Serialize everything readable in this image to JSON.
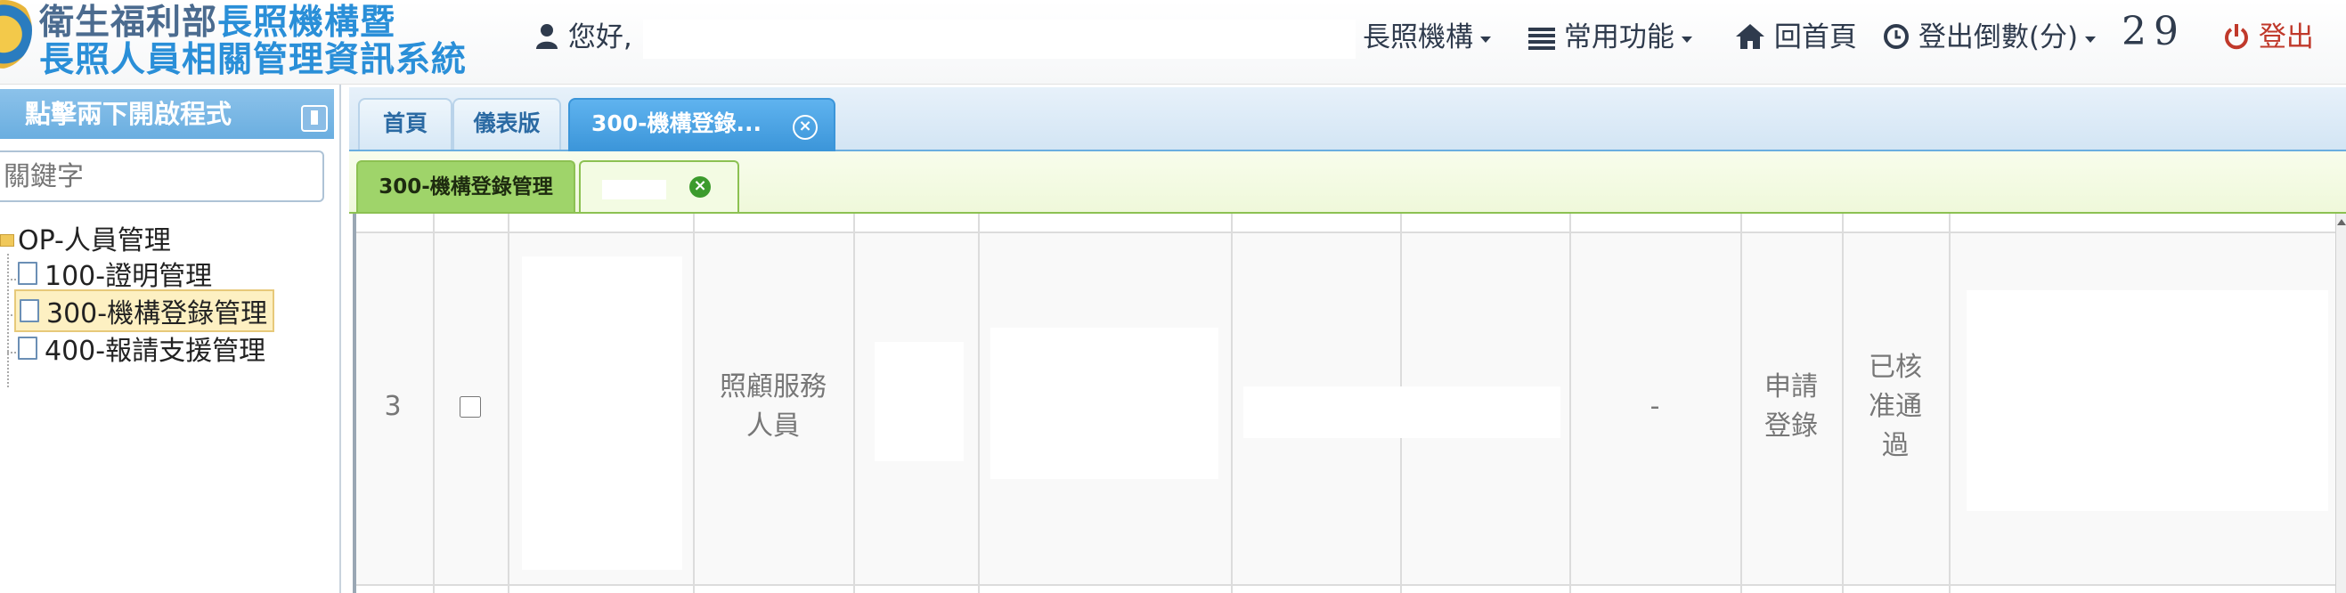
{
  "header": {
    "title_line1_part1": "衛生福利部",
    "title_line1_part2": "長照機構暨",
    "title_line2": "長照人員相關管理資訊系統",
    "greeting": "您好,",
    "nav": {
      "org": "長照機構",
      "common": "常用功能",
      "home": "回首頁",
      "logout_timer": "登出倒數(分)",
      "countdown": "29",
      "logout": "登出"
    }
  },
  "sidebar": {
    "title": "點擊兩下開啟程式",
    "search_placeholder": "關鍵字",
    "tree": {
      "root": "OP-人員管理",
      "items": [
        {
          "label": "100-證明管理"
        },
        {
          "label": "300-機構登錄管理"
        },
        {
          "label": "400-報請支援管理"
        }
      ]
    }
  },
  "tabs": {
    "home": "首頁",
    "dashboard": "儀表版",
    "active": "300-機構登錄..."
  },
  "subtabs": {
    "active": "300-機構登錄管理"
  },
  "grid": {
    "row": {
      "no": "3",
      "role": "照顧服務人員",
      "dash": "-",
      "action": "申請登錄",
      "status": "已核准通過"
    }
  },
  "colors": {
    "accent_blue": "#3b95d9",
    "sidebar_header": "#6aaee0",
    "subtab_green": "#9fd46a",
    "logout_red": "#c0392b"
  }
}
